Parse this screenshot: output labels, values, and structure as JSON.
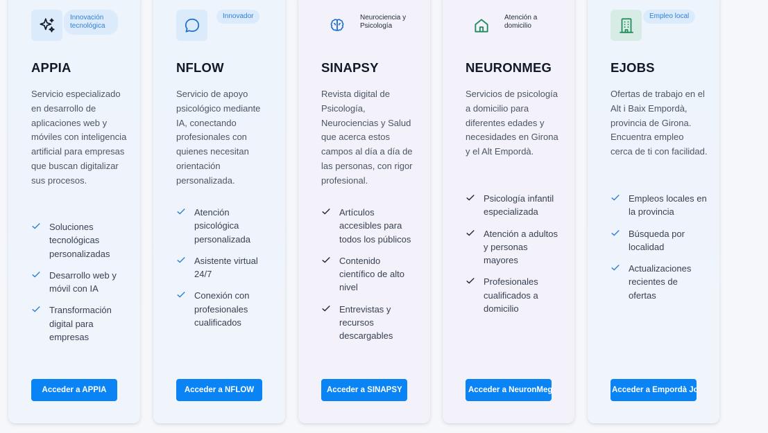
{
  "cards": [
    {
      "name": "APPIA",
      "badge": "Innovación tecnológica",
      "icon": "sparkles-icon",
      "description": "Servicio especializado en desarrollo de aplicaciones web y móviles con inteligencia artificial para empresas que buscan digitalizar sus procesos.",
      "features": [
        "Soluciones tecnológicas personalizadas",
        "Desarrollo web y móvil con IA",
        "Transformación digital para empresas"
      ],
      "button": "Acceder a APPIA"
    },
    {
      "name": "NFLOW",
      "badge": "Innovador",
      "icon": "chat-bubble-icon",
      "description": "Servicio de apoyo psicológico mediante IA, conectando profesionales con quienes necesitan orientación personalizada.",
      "features": [
        "Atención psicológica personalizada",
        "Asistente virtual 24/7",
        "Conexión con profesionales cualificados"
      ],
      "button": "Acceder a NFLOW"
    },
    {
      "name": "SINAPSY",
      "badge": "Neurociencia y Psicología",
      "icon": "brain-icon",
      "description": "Revista digital de Psicología, Neurociencias y Salud que acerca estos campos al día a día de las personas, con rigor profesional.",
      "features": [
        "Artículos accesibles para todos los públicos",
        "Contenido científico de alto nivel",
        "Entrevistas y recursos descargables"
      ],
      "button": "Acceder a SINAPSY"
    },
    {
      "name": "NEURONMEG",
      "badge": "Atención a domicilio",
      "icon": "home-icon",
      "description": "Servicios de psicología a domicilio para diferentes edades y necesidades en Girona y el Alt Empordà.",
      "features": [
        "Psicología infantil especializada",
        "Atención a adultos y personas mayores",
        "Profesionales cualificados a domicilio"
      ],
      "button": "Acceder a NeuronMeg"
    },
    {
      "name": "EJOBS",
      "badge": "Empleo local",
      "icon": "building-icon",
      "description": "Ofertas de trabajo en el Alt i Baix Empordà, provincia de Girona. Encuentra empleo cerca de ti con facilidad.",
      "features": [
        "Empleos locales en la provincia",
        "Búsqueda por localidad",
        "Actualizaciones recientes de ofertas"
      ],
      "button": "Acceder a Empordà Jobs"
    }
  ],
  "colors": {
    "accent": "#0a84f5",
    "badge_text": "#2f7fd6",
    "check_blue": "#2f7fd6",
    "check_dark": "#1f2937",
    "green_icon": "#1f8a5b"
  }
}
